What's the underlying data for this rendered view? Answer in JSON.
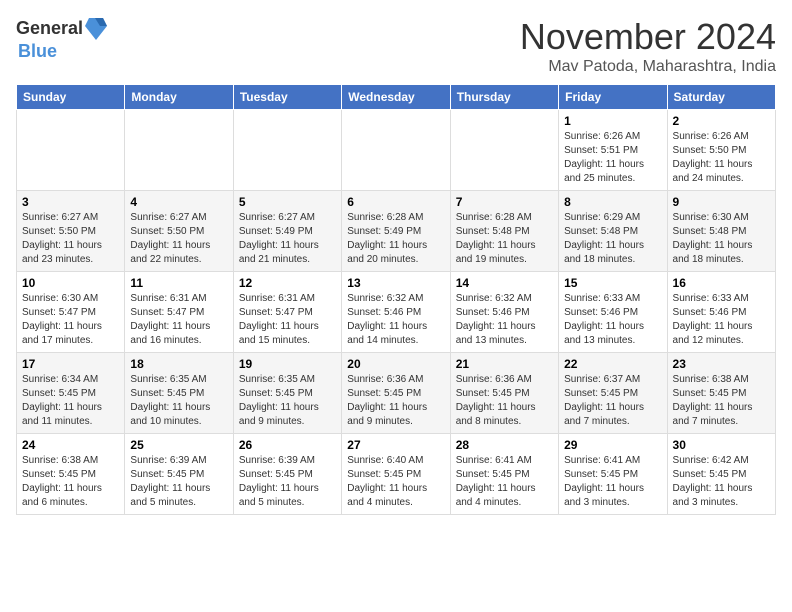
{
  "logo": {
    "line1": "General",
    "line2": "Blue"
  },
  "header": {
    "month": "November 2024",
    "location": "Mav Patoda, Maharashtra, India"
  },
  "weekdays": [
    "Sunday",
    "Monday",
    "Tuesday",
    "Wednesday",
    "Thursday",
    "Friday",
    "Saturday"
  ],
  "weeks": [
    [
      {
        "day": "",
        "info": ""
      },
      {
        "day": "",
        "info": ""
      },
      {
        "day": "",
        "info": ""
      },
      {
        "day": "",
        "info": ""
      },
      {
        "day": "",
        "info": ""
      },
      {
        "day": "1",
        "info": "Sunrise: 6:26 AM\nSunset: 5:51 PM\nDaylight: 11 hours and 25 minutes."
      },
      {
        "day": "2",
        "info": "Sunrise: 6:26 AM\nSunset: 5:50 PM\nDaylight: 11 hours and 24 minutes."
      }
    ],
    [
      {
        "day": "3",
        "info": "Sunrise: 6:27 AM\nSunset: 5:50 PM\nDaylight: 11 hours and 23 minutes."
      },
      {
        "day": "4",
        "info": "Sunrise: 6:27 AM\nSunset: 5:50 PM\nDaylight: 11 hours and 22 minutes."
      },
      {
        "day": "5",
        "info": "Sunrise: 6:27 AM\nSunset: 5:49 PM\nDaylight: 11 hours and 21 minutes."
      },
      {
        "day": "6",
        "info": "Sunrise: 6:28 AM\nSunset: 5:49 PM\nDaylight: 11 hours and 20 minutes."
      },
      {
        "day": "7",
        "info": "Sunrise: 6:28 AM\nSunset: 5:48 PM\nDaylight: 11 hours and 19 minutes."
      },
      {
        "day": "8",
        "info": "Sunrise: 6:29 AM\nSunset: 5:48 PM\nDaylight: 11 hours and 18 minutes."
      },
      {
        "day": "9",
        "info": "Sunrise: 6:30 AM\nSunset: 5:48 PM\nDaylight: 11 hours and 18 minutes."
      }
    ],
    [
      {
        "day": "10",
        "info": "Sunrise: 6:30 AM\nSunset: 5:47 PM\nDaylight: 11 hours and 17 minutes."
      },
      {
        "day": "11",
        "info": "Sunrise: 6:31 AM\nSunset: 5:47 PM\nDaylight: 11 hours and 16 minutes."
      },
      {
        "day": "12",
        "info": "Sunrise: 6:31 AM\nSunset: 5:47 PM\nDaylight: 11 hours and 15 minutes."
      },
      {
        "day": "13",
        "info": "Sunrise: 6:32 AM\nSunset: 5:46 PM\nDaylight: 11 hours and 14 minutes."
      },
      {
        "day": "14",
        "info": "Sunrise: 6:32 AM\nSunset: 5:46 PM\nDaylight: 11 hours and 13 minutes."
      },
      {
        "day": "15",
        "info": "Sunrise: 6:33 AM\nSunset: 5:46 PM\nDaylight: 11 hours and 13 minutes."
      },
      {
        "day": "16",
        "info": "Sunrise: 6:33 AM\nSunset: 5:46 PM\nDaylight: 11 hours and 12 minutes."
      }
    ],
    [
      {
        "day": "17",
        "info": "Sunrise: 6:34 AM\nSunset: 5:45 PM\nDaylight: 11 hours and 11 minutes."
      },
      {
        "day": "18",
        "info": "Sunrise: 6:35 AM\nSunset: 5:45 PM\nDaylight: 11 hours and 10 minutes."
      },
      {
        "day": "19",
        "info": "Sunrise: 6:35 AM\nSunset: 5:45 PM\nDaylight: 11 hours and 9 minutes."
      },
      {
        "day": "20",
        "info": "Sunrise: 6:36 AM\nSunset: 5:45 PM\nDaylight: 11 hours and 9 minutes."
      },
      {
        "day": "21",
        "info": "Sunrise: 6:36 AM\nSunset: 5:45 PM\nDaylight: 11 hours and 8 minutes."
      },
      {
        "day": "22",
        "info": "Sunrise: 6:37 AM\nSunset: 5:45 PM\nDaylight: 11 hours and 7 minutes."
      },
      {
        "day": "23",
        "info": "Sunrise: 6:38 AM\nSunset: 5:45 PM\nDaylight: 11 hours and 7 minutes."
      }
    ],
    [
      {
        "day": "24",
        "info": "Sunrise: 6:38 AM\nSunset: 5:45 PM\nDaylight: 11 hours and 6 minutes."
      },
      {
        "day": "25",
        "info": "Sunrise: 6:39 AM\nSunset: 5:45 PM\nDaylight: 11 hours and 5 minutes."
      },
      {
        "day": "26",
        "info": "Sunrise: 6:39 AM\nSunset: 5:45 PM\nDaylight: 11 hours and 5 minutes."
      },
      {
        "day": "27",
        "info": "Sunrise: 6:40 AM\nSunset: 5:45 PM\nDaylight: 11 hours and 4 minutes."
      },
      {
        "day": "28",
        "info": "Sunrise: 6:41 AM\nSunset: 5:45 PM\nDaylight: 11 hours and 4 minutes."
      },
      {
        "day": "29",
        "info": "Sunrise: 6:41 AM\nSunset: 5:45 PM\nDaylight: 11 hours and 3 minutes."
      },
      {
        "day": "30",
        "info": "Sunrise: 6:42 AM\nSunset: 5:45 PM\nDaylight: 11 hours and 3 minutes."
      }
    ]
  ]
}
